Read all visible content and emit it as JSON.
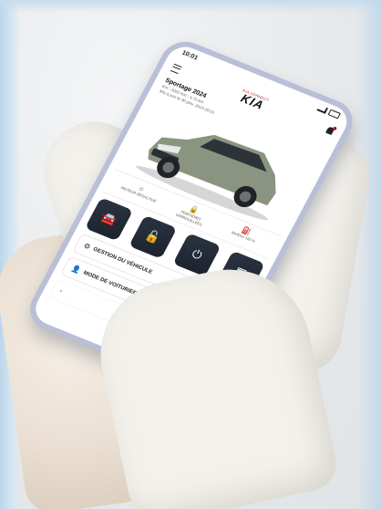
{
  "phone": {
    "status_time": "10:01",
    "brand_tag": "KIA CONNECT",
    "brand_logo": "KIA",
    "vehicle": {
      "name": "Sportage 2024",
      "meta": "Km : 2022   Km : 4,70 km",
      "meta2": "Mis à jour le 30 janv. 2024 09:21"
    },
    "status_items": [
      {
        "glyph": "☼",
        "text": "Moteur désactivé",
        "icon": "engine-status-icon"
      },
      {
        "glyph": "🔒",
        "text": "Portières verrouillées",
        "icon": "lock-status-icon"
      },
      {
        "glyph": "⛽",
        "text": "Niveau 100 %",
        "icon": "fuel-status-icon"
      }
    ],
    "controls": [
      {
        "glyph": "🚘",
        "icon": "car-icon"
      },
      {
        "glyph": "🔓",
        "icon": "unlock-icon"
      },
      {
        "glyph": "⏻",
        "icon": "power-icon"
      },
      {
        "glyph": "▦",
        "icon": "map-icon"
      }
    ],
    "menu": [
      {
        "label": "Gestion du véhicule",
        "glyph": "⚙",
        "icon": "vehicle-management-icon"
      },
      {
        "label": "Mode de voiturier",
        "glyph": "👤",
        "icon": "valet-mode-icon"
      }
    ]
  },
  "colors": {
    "accent": "#c3151c",
    "control_bg": "#1b222d",
    "phone_frame": "#b9bfd6",
    "car_body": "#8a9480"
  }
}
